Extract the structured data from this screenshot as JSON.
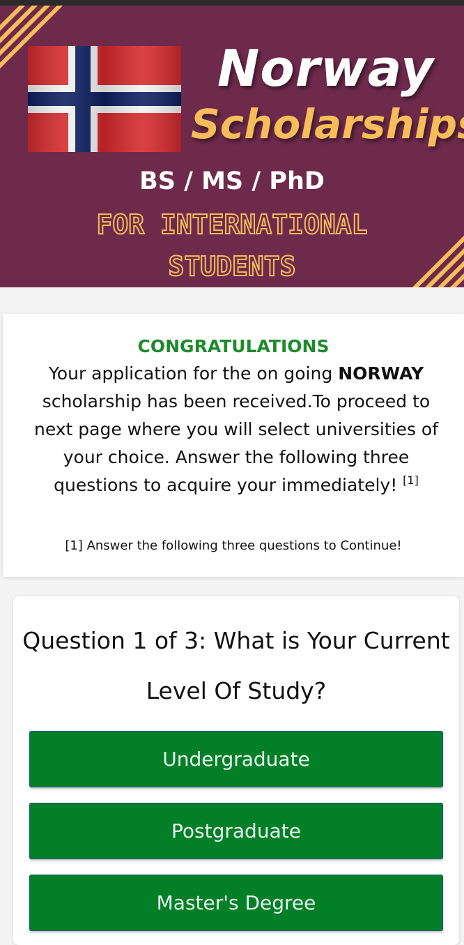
{
  "banner": {
    "title_line1": "Norway",
    "title_line2": "Scholarships",
    "degrees": "BS / MS / PhD",
    "subtitle_line1": "FOR INTERNATIONAL",
    "subtitle_line2": "STUDENTS",
    "colors": {
      "background": "#6e2a4b",
      "accent": "#f6bd5a",
      "white": "#ffffff"
    },
    "flag_icon": "norway-flag-icon"
  },
  "notice": {
    "heading": "CONGRATULATIONS",
    "text_before_bold": "Your application for the on going ",
    "bold": "NORWAY",
    "text_after_bold": " scholarship has been received.To proceed to next page where you will select universities of your choice. Answer the following three questions to acquire your immediately! ",
    "footnote_ref": "[1]",
    "footnote": "[1] Answer the following three questions to Continue!",
    "heading_color": "#1d8a2c"
  },
  "quiz": {
    "question": "Question 1 of 3: What is Your Current Level Of Study?",
    "options": [
      {
        "label": "Undergraduate"
      },
      {
        "label": "Postgraduate"
      },
      {
        "label": "Master's Degree"
      }
    ],
    "button_color": "#037f28"
  }
}
